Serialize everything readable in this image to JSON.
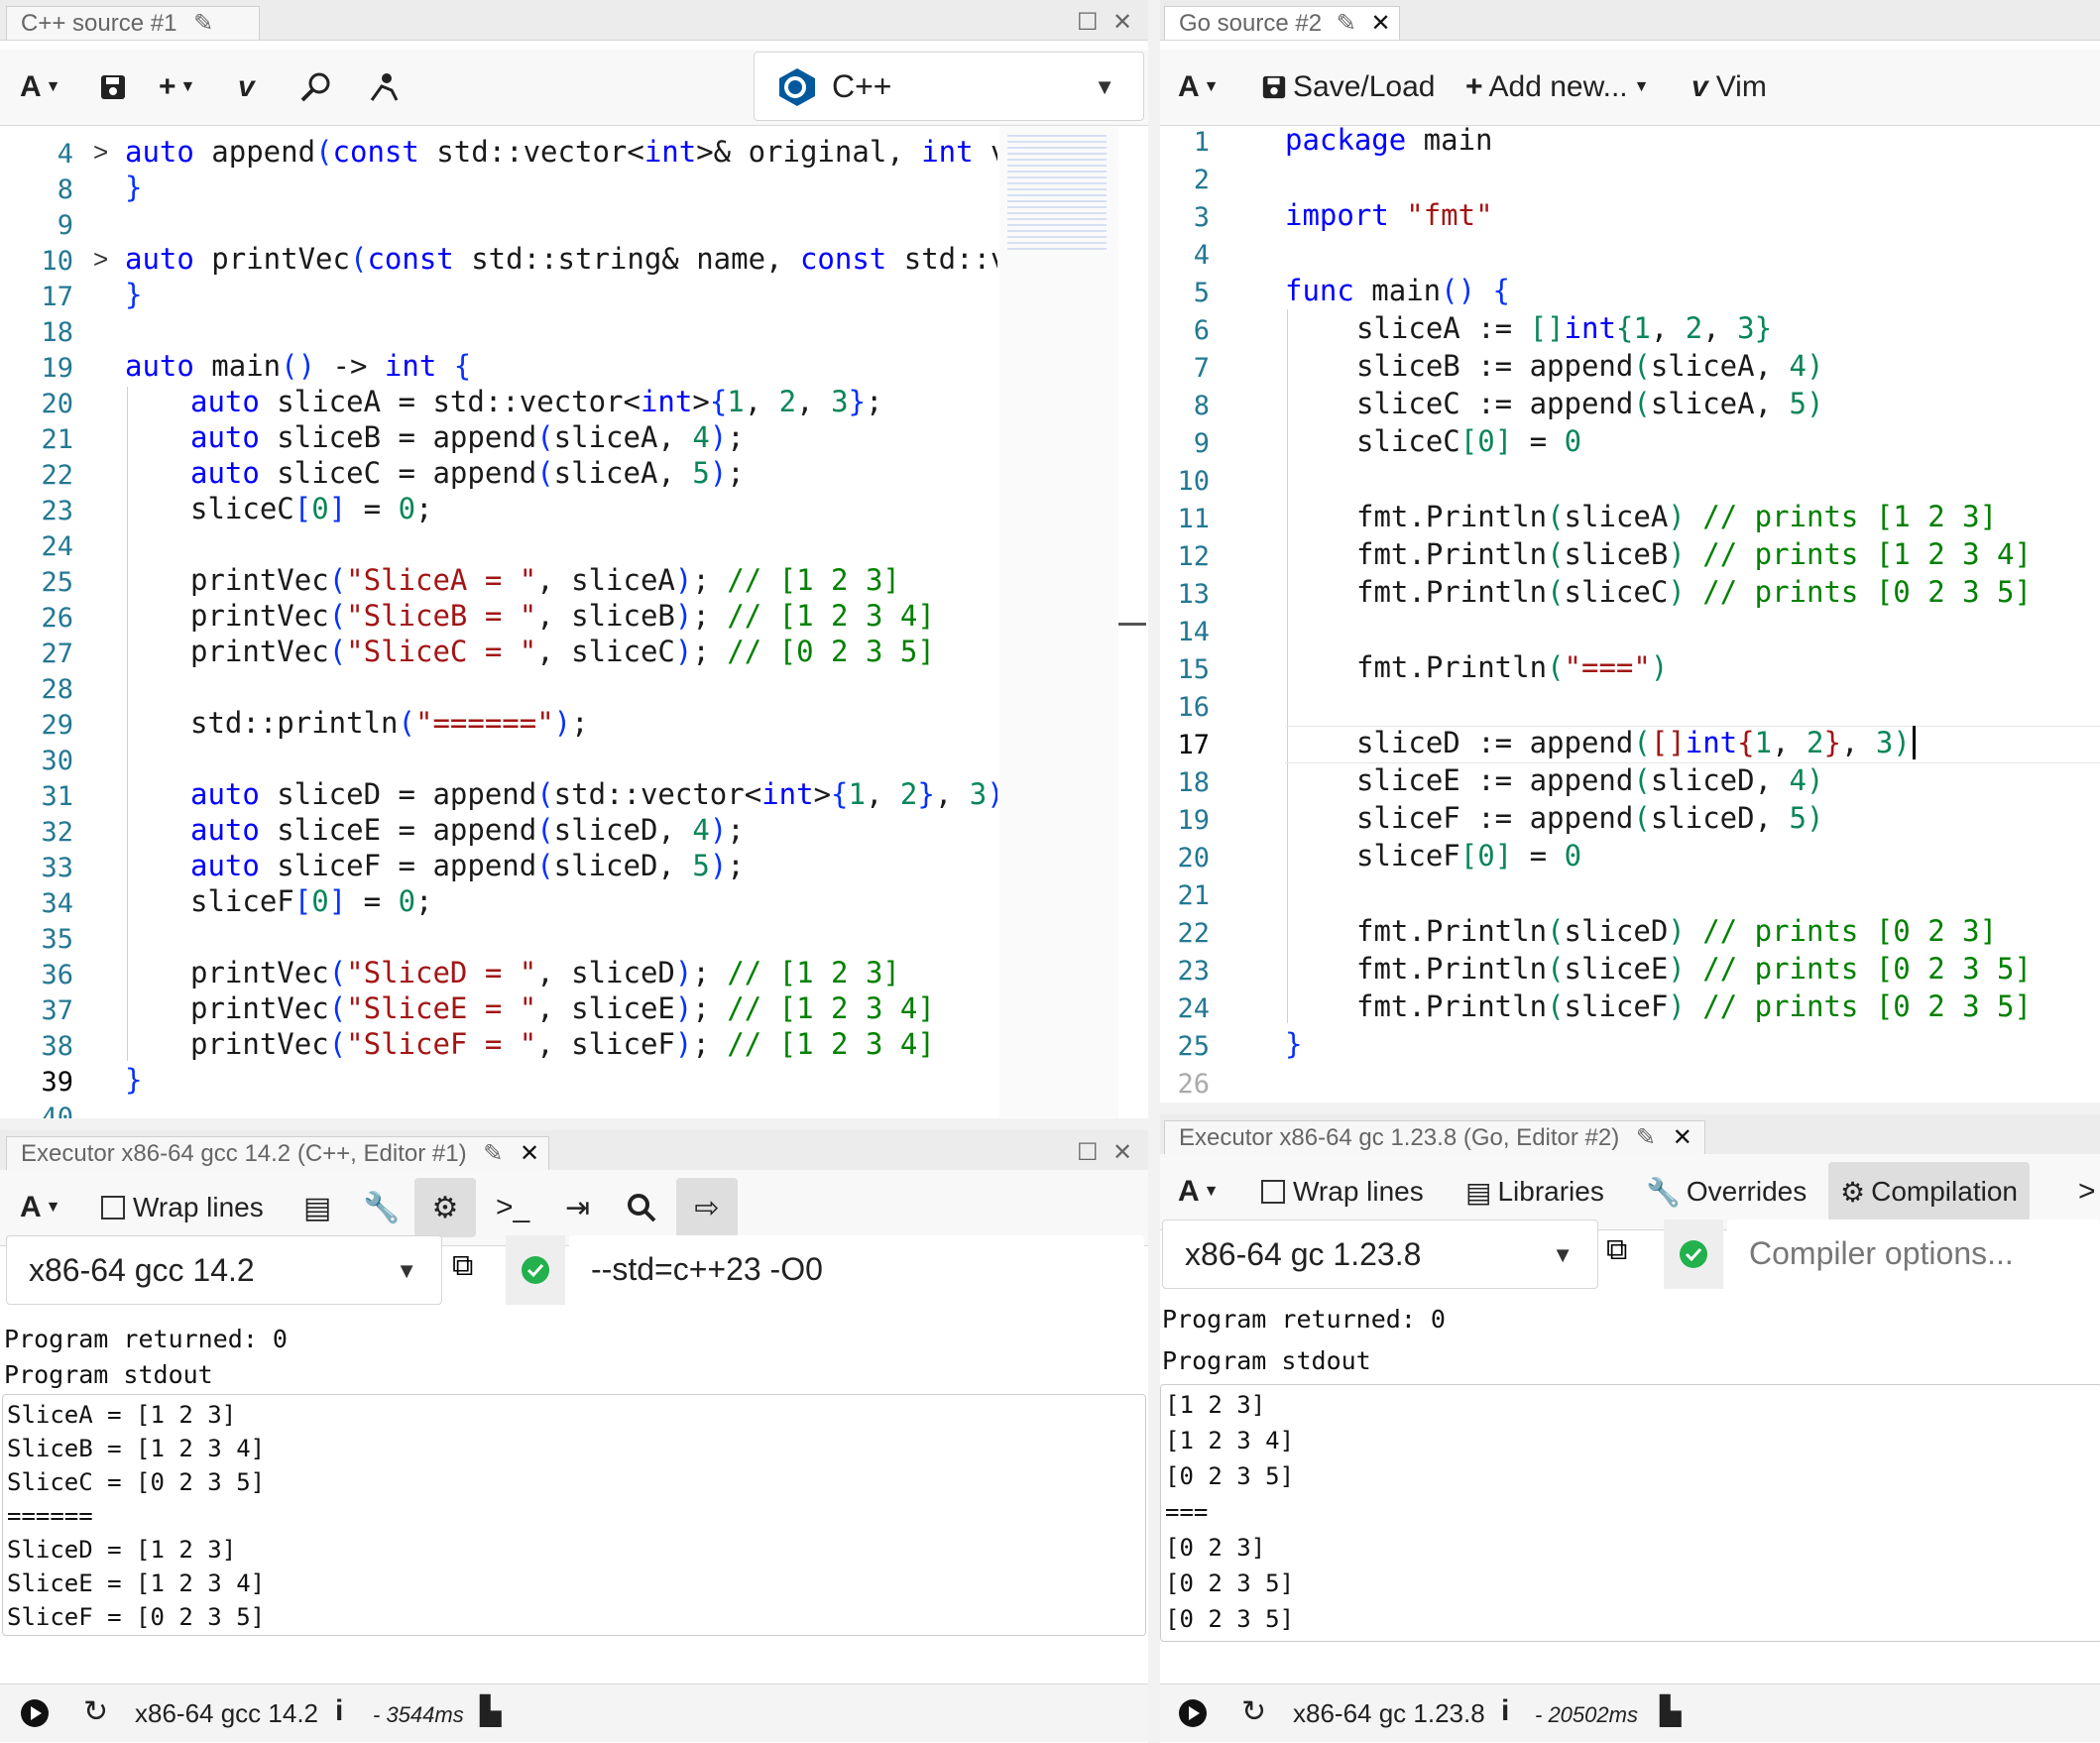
{
  "cpp_editor": {
    "tab_title": "C++ source #1",
    "toolbar": {
      "font_label": "A",
      "language": "C++"
    },
    "line_numbers": [
      "4",
      "8",
      "9",
      "10",
      "17",
      "18",
      "19",
      "20",
      "21",
      "22",
      "23",
      "24",
      "25",
      "26",
      "27",
      "28",
      "29",
      "30",
      "31",
      "32",
      "33",
      "34",
      "35",
      "36",
      "37",
      "38",
      "39",
      "40"
    ]
  },
  "go_editor": {
    "tab_title": "Go source #2",
    "toolbar": {
      "font_label": "A",
      "save_load": "Save/Load",
      "add_new": "Add new...",
      "vim": "Vim"
    },
    "line_numbers": [
      "1",
      "2",
      "3",
      "4",
      "5",
      "6",
      "7",
      "8",
      "9",
      "10",
      "11",
      "12",
      "13",
      "14",
      "15",
      "16",
      "17",
      "18",
      "19",
      "20",
      "21",
      "22",
      "23",
      "24",
      "25",
      "26"
    ]
  },
  "cpp_executor": {
    "tab_title": "Executor x86-64 gcc 14.2 (C++, Editor #1)",
    "wrap_lines": "Wrap lines",
    "compiler": "x86-64 gcc 14.2",
    "options": "--std=c++23 -O0",
    "returned": "Program returned: 0",
    "stdout_label": "Program stdout",
    "output": [
      "SliceA = [1 2 3]",
      "SliceB = [1 2 3 4]",
      "SliceC = [0 2 3 5]",
      "======",
      "SliceD = [1 2 3]",
      "SliceE = [1 2 3 4]",
      "SliceF = [0 2 3 5]"
    ],
    "status_compiler": "x86-64 gcc 14.2",
    "status_time": "- 3544ms"
  },
  "go_executor": {
    "tab_title": "Executor x86-64 gc 1.23.8 (Go, Editor #2)",
    "wrap_lines": "Wrap lines",
    "libraries": "Libraries",
    "overrides": "Overrides",
    "compilation": "Compilation",
    "compiler": "x86-64 gc 1.23.8",
    "options_placeholder": "Compiler options...",
    "returned": "Program returned: 0",
    "stdout_label": "Program stdout",
    "output": [
      "[1 2 3]",
      "[1 2 3 4]",
      "[0 2 3 5]",
      "===",
      "[0 2 3]",
      "[0 2 3 5]",
      "[0 2 3 5]"
    ],
    "status_compiler": "x86-64 gc 1.23.8",
    "status_time": "- 20502ms"
  },
  "colors": {
    "keyword": "#0000ff",
    "number": "#098658",
    "string": "#a31515",
    "comment": "#008000",
    "linenumber": "#237893",
    "ok": "#22b14c"
  }
}
